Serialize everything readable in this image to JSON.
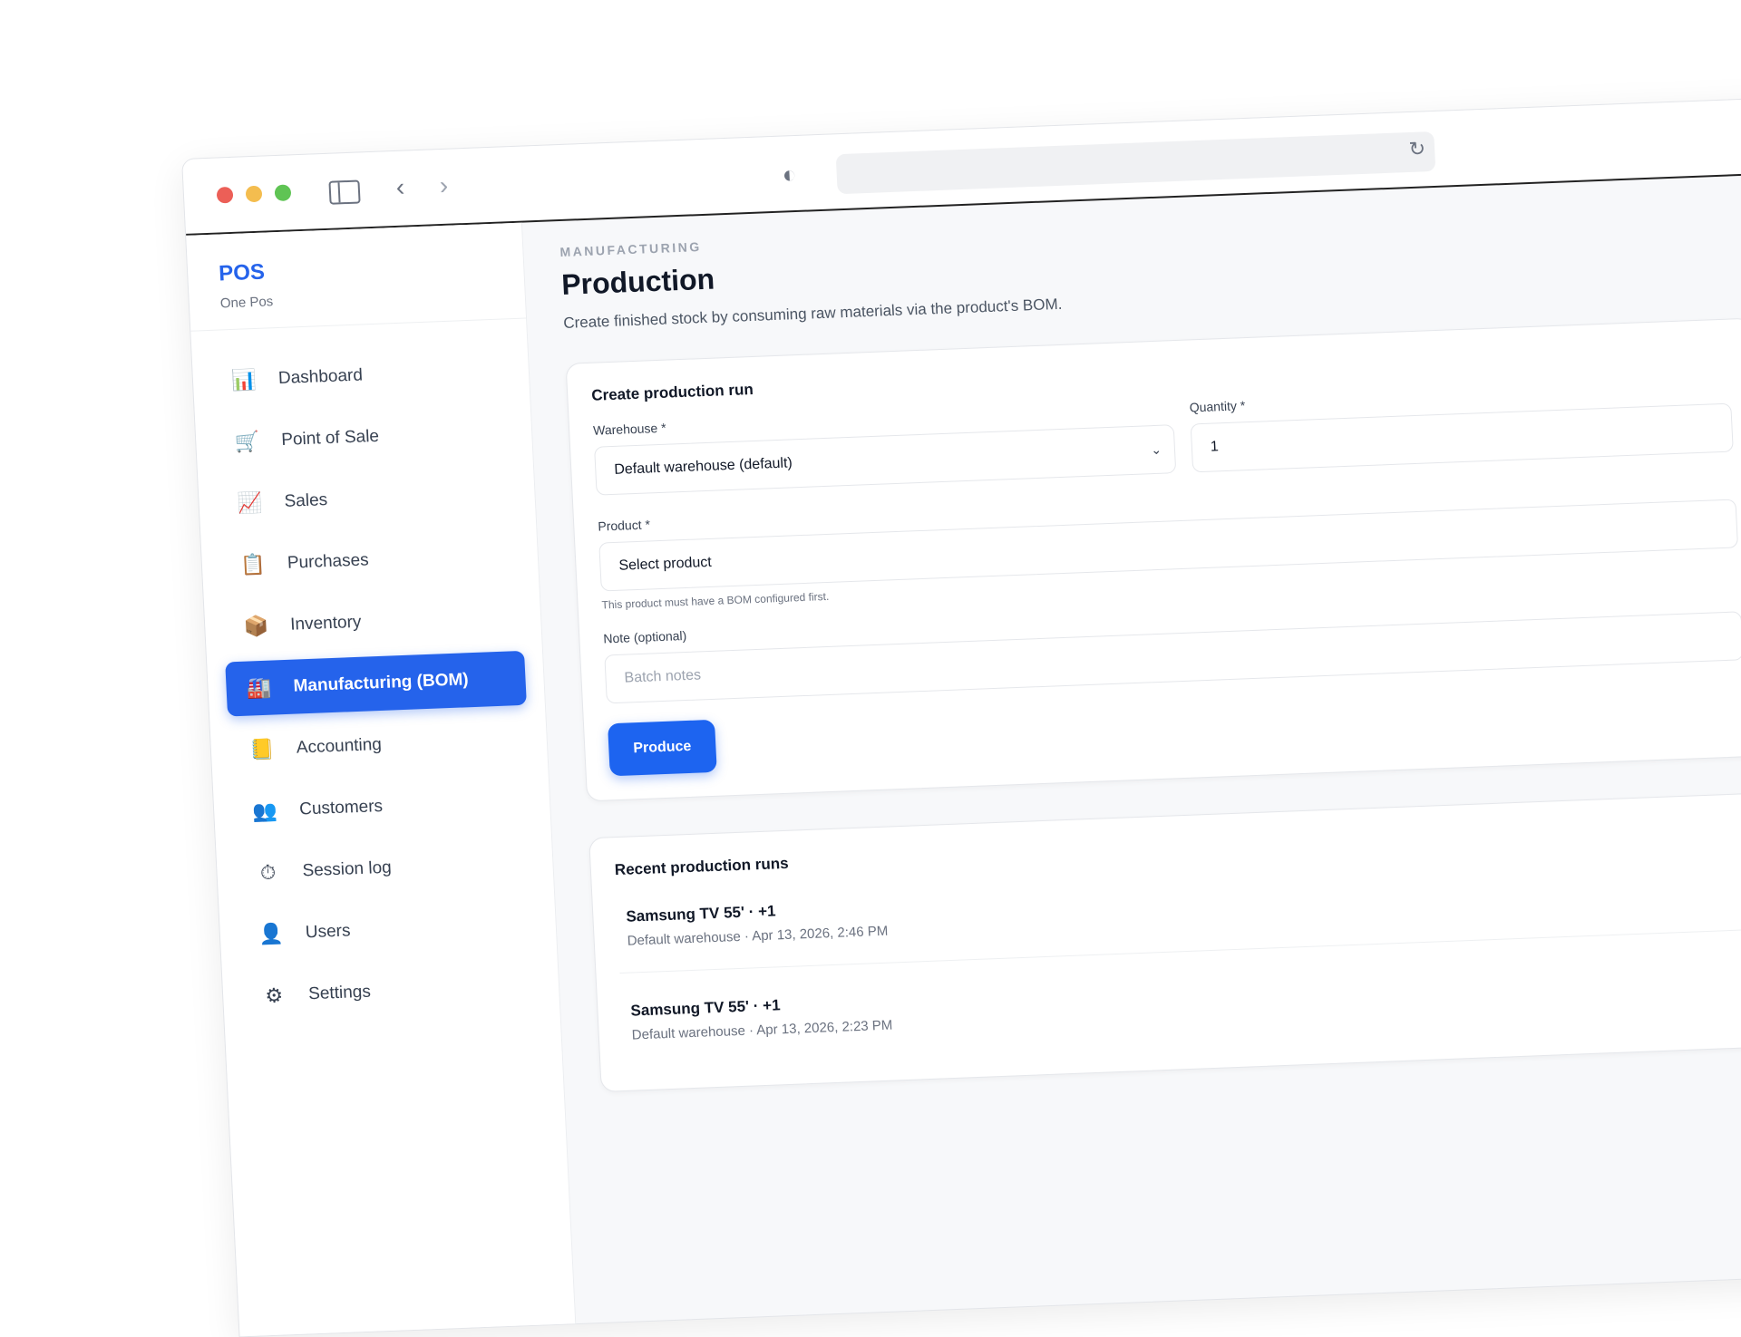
{
  "brand": {
    "name": "POS",
    "subtitle": "One Pos"
  },
  "sidebar": {
    "items": [
      {
        "label": "Dashboard",
        "icon": "📊"
      },
      {
        "label": "Point of Sale",
        "icon": "🛒"
      },
      {
        "label": "Sales",
        "icon": "📈"
      },
      {
        "label": "Purchases",
        "icon": "📋"
      },
      {
        "label": "Inventory",
        "icon": "📦"
      },
      {
        "label": "Manufacturing (BOM)",
        "icon": "🏭"
      },
      {
        "label": "Accounting",
        "icon": "📒"
      },
      {
        "label": "Customers",
        "icon": "👥"
      },
      {
        "label": "Session log",
        "icon": "⏱"
      },
      {
        "label": "Users",
        "icon": "👤"
      },
      {
        "label": "Settings",
        "icon": "⚙"
      }
    ],
    "active_index": 5
  },
  "page": {
    "eyebrow": "MANUFACTURING",
    "title": "Production",
    "subtitle": "Create finished stock by consuming raw materials via the product's BOM."
  },
  "form": {
    "title": "Create production run",
    "warehouse_label": "Warehouse *",
    "warehouse_value": "Default warehouse (default)",
    "quantity_label": "Quantity *",
    "quantity_value": "1",
    "product_label": "Product *",
    "product_value": "Select product",
    "product_hint": "This product must have a BOM configured first.",
    "note_label": "Note (optional)",
    "note_placeholder": "Batch notes",
    "submit_label": "Produce"
  },
  "recent": {
    "title": "Recent production runs",
    "runs": [
      {
        "title": "Samsung TV 55' · +1",
        "meta": "Default warehouse · Apr 13, 2026, 2:46 PM"
      },
      {
        "title": "Samsung TV 55' · +1",
        "meta": "Default warehouse · Apr 13, 2026, 2:23 PM"
      }
    ]
  },
  "colors": {
    "accent": "#2563eb",
    "button": "#1d64f0"
  }
}
